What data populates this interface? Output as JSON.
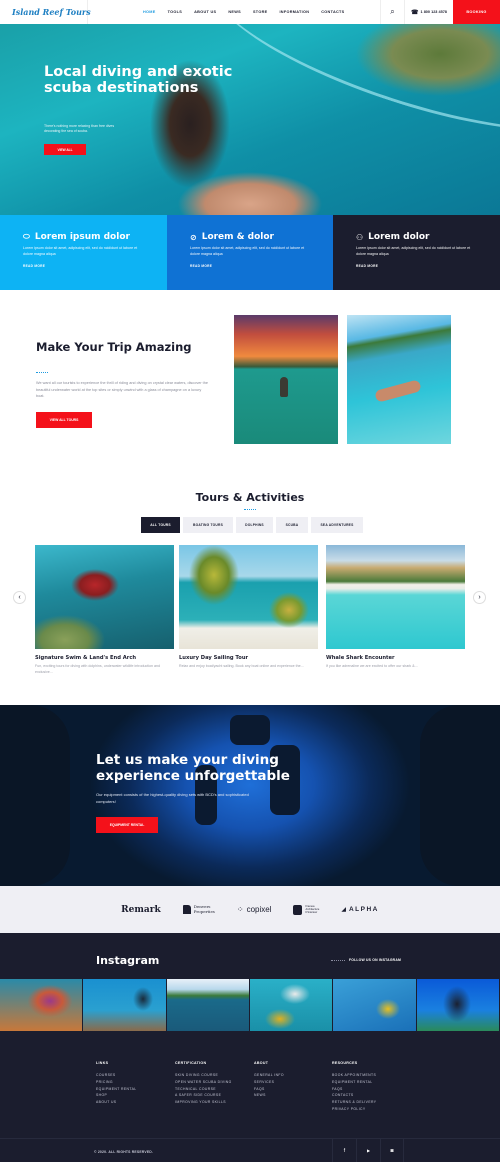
{
  "header": {
    "logo_text": "Island Reef Tours",
    "nav": [
      {
        "label": "HOME",
        "active": true
      },
      {
        "label": "TOOLS"
      },
      {
        "label": "ABOUT US"
      },
      {
        "label": "NEWS"
      },
      {
        "label": "STORE"
      },
      {
        "label": "INFORMATION"
      },
      {
        "label": "CONTACTS"
      }
    ],
    "search_icon": "search-icon",
    "phone_icon": "phone-icon",
    "phone": "1 800 123 4578",
    "booking_label": "BOOKING",
    "accent_color": "#f4111a"
  },
  "hero": {
    "title": "Local diving and exotic scuba destinations",
    "subtitle": "There's nothing more relaxing than free dives decorating the sea of scuba.",
    "button_label": "VIEW ALL"
  },
  "features": [
    {
      "icon": "diving-mask-icon",
      "title": "Lorem ipsum dolor",
      "text": "Lorem ipsum dolor sit amet, adipiscing elit, sed do ncididunt ut labore et dolore magna aliqua",
      "link": "READ MORE",
      "color": "#0db3f4"
    },
    {
      "icon": "compass-icon",
      "title": "Lorem & dolor",
      "text": "Lorem ipsum dolor sit amet, adipiscing elit, sed do ncididunt ut labore et dolore magna aliqua",
      "link": "READ MORE",
      "color": "#0f72d4"
    },
    {
      "icon": "oxygen-tank-icon",
      "title": "Lorem dolor",
      "text": "Lorem ipsum dolor sit amet, adipiscing elit, sed do ncididunt ut labore et dolore magna aliqua",
      "link": "READ MORE",
      "color": "#1b1d2e"
    }
  ],
  "trip": {
    "title": "Make Your Trip Amazing",
    "text": "We want all our tourists to experience the thrill of riding and diving on crystal clear waters, discover the beautiful underwater world at the top sites or simply unwind with a glass of champagne on a luxury boat.",
    "button_label": "VIEW ALL TOURS"
  },
  "tours": {
    "title": "Tours & Activities",
    "tabs": [
      {
        "label": "ALL TOURS",
        "active": true
      },
      {
        "label": "BOATING TOURS"
      },
      {
        "label": "DOLPHINS"
      },
      {
        "label": "SCUBA"
      },
      {
        "label": "SEA ADVENTURES"
      }
    ],
    "prev_icon": "chevron-left-icon",
    "next_icon": "chevron-right-icon",
    "cards": [
      {
        "title": "Signature Swim & Land's End Arch",
        "text": "Fun, exciting tours for diving with dolphins, underwater wildlife introduction and exclusive..."
      },
      {
        "title": "Luxury Day Sailing Tour",
        "text": "Relax and enjoy boat/yacht sailing. Book any boat online and experience the..."
      },
      {
        "title": "Whale Shark Encounter",
        "text": "If you like adrenaline we are excited to offer our shark &..."
      }
    ]
  },
  "diving": {
    "title": "Let us make your diving experience unforgettable",
    "text": "Our equipment consists of the highest-quality diving sets with BCD's and sophisticated computers!",
    "button_label": "EQUIPMENT RENTAL"
  },
  "partners": [
    {
      "name": "Remark"
    },
    {
      "name": "Denvers Properties",
      "line1": "Denvers",
      "line2": "Properties"
    },
    {
      "name": "copixel"
    },
    {
      "name": "Framea Architecture D'interieur",
      "line1": "Framea",
      "line2": "Architecture",
      "line3": "D'interieur"
    },
    {
      "name": "ALPHA"
    }
  ],
  "instagram": {
    "title": "Instagram",
    "follow_label": "FOLLOW US ON INSTAGRAM",
    "photos": [
      "sea-turtle",
      "diver-with-fish",
      "snorkeler-half-water",
      "tropical-fish",
      "snorkeler-mask",
      "scuba-diver"
    ]
  },
  "footer": {
    "columns": [
      {
        "heading": "LINKS",
        "items": [
          "COURSES",
          "PRICING",
          "EQUIPMENT RENTAL",
          "SHOP",
          "ABOUT US"
        ]
      },
      {
        "heading": "CERTIFICATION",
        "items": [
          "SKIN DIVING COURSE",
          "OPEN WATER SCUBA DIVING",
          "TECHNICAL COURSE",
          "A SAFER SIDE COURSE",
          "IMPROVING YOUR SKILLS"
        ]
      },
      {
        "heading": "ABOUT",
        "items": [
          "GENERAL INFO",
          "SERVICES",
          "FAQS",
          "NEWS"
        ]
      },
      {
        "heading": "RESOURCES",
        "items": [
          "BOOK APPOINTMENTS",
          "EQUIPMENT RENTAL",
          "FAQS",
          "CONTACTS",
          "RETURNS & DELIVERY",
          "PRIVACY POLICY"
        ]
      }
    ],
    "copyright": "© 2020. ALL RIGHTS RESERVED.",
    "social": [
      {
        "icon": "facebook-icon",
        "glyph": "f"
      },
      {
        "icon": "twitter-icon",
        "glyph": "🐦"
      },
      {
        "icon": "instagram-icon",
        "glyph": "◙"
      }
    ]
  }
}
